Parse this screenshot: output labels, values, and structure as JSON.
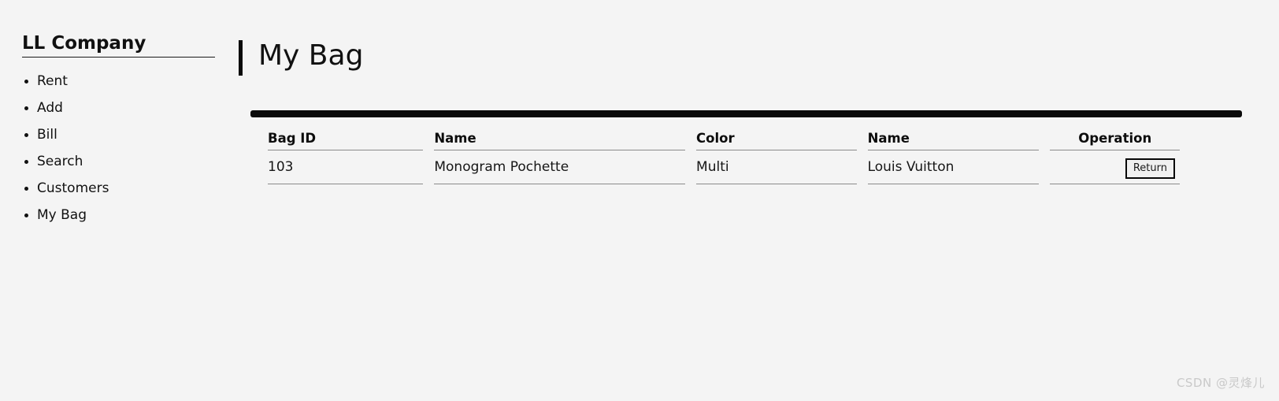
{
  "sidebar": {
    "brand": "LL Company",
    "items": [
      {
        "label": "Rent"
      },
      {
        "label": "Add"
      },
      {
        "label": "Bill"
      },
      {
        "label": "Search"
      },
      {
        "label": "Customers"
      },
      {
        "label": "My Bag"
      }
    ]
  },
  "main": {
    "page_title": "My Bag",
    "table": {
      "headers": [
        "Bag ID",
        "Name",
        "Color",
        "Name",
        "Operation"
      ],
      "rows": [
        {
          "bag_id": "103",
          "name": "Monogram Pochette",
          "color": "Multi",
          "brand": "Louis Vuitton",
          "operation_label": "Return"
        }
      ]
    }
  },
  "watermark": "CSDN @灵烽儿",
  "colors": {
    "page_background": "#f4f4f4",
    "text": "#111111",
    "accent_bar": "#0b0b0b",
    "table_topbar": "#0a0a0a",
    "cell_rule": "#8a8a8a",
    "watermark": "#c9c9c9"
  }
}
